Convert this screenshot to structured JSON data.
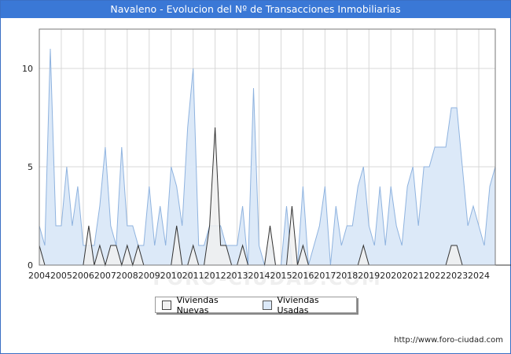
{
  "title": "Navaleno - Evolucion del Nº de Transacciones Inmobiliarias",
  "footer": "http://www.foro-ciudad.com",
  "watermark": "FORO-CIUDAD.COM",
  "colors": {
    "header": "#3a78d6",
    "nuevas_fill": "#f0f0f0",
    "nuevas_line": "#333333",
    "usadas_fill": "#dce9f8",
    "usadas_line": "#8fb3df",
    "grid": "#d8d8d8"
  },
  "chart_data": {
    "type": "area",
    "x_ticks": [
      "2004",
      "2005",
      "2006",
      "2007",
      "2008",
      "2009",
      "2010",
      "2011",
      "2012",
      "2013",
      "2014",
      "2015",
      "2016",
      "2017",
      "2018",
      "2019",
      "2020",
      "2021",
      "2022",
      "2023",
      "2024"
    ],
    "y_ticks": [
      0,
      5,
      10
    ],
    "ylim": [
      0,
      12
    ],
    "xlim": [
      2004,
      2024.75
    ],
    "grid": true,
    "legend_position": "bottom",
    "series": [
      {
        "name": "Viviendas Nuevas",
        "values": [
          1,
          0,
          0,
          0,
          0,
          0,
          0,
          0,
          0,
          2,
          0,
          1,
          0,
          1,
          1,
          0,
          1,
          0,
          1,
          0,
          0,
          0,
          0,
          0,
          0,
          2,
          0,
          0,
          1,
          0,
          0,
          2,
          7,
          1,
          1,
          0,
          0,
          1,
          0,
          0,
          0,
          0,
          2,
          0,
          0,
          0,
          3,
          0,
          1,
          0,
          0,
          0,
          0,
          0,
          0,
          0,
          0,
          0,
          0,
          1,
          0,
          0,
          0,
          0,
          0,
          0,
          0,
          0,
          0,
          0,
          0,
          0,
          0,
          0,
          0,
          1,
          1,
          0,
          0,
          0,
          0,
          0,
          0,
          0,
          0,
          0,
          0,
          0,
          0,
          0,
          0,
          0,
          0,
          0,
          0,
          0
        ]
      },
      {
        "name": "Viviendas Usadas",
        "values": [
          2,
          1,
          11,
          2,
          2,
          5,
          2,
          4,
          1,
          1,
          1,
          3,
          6,
          2,
          1,
          6,
          2,
          2,
          1,
          1,
          4,
          1,
          3,
          1,
          5,
          4,
          2,
          7,
          10,
          1,
          1,
          2,
          2,
          2,
          1,
          1,
          1,
          3,
          0,
          9,
          1,
          0,
          1,
          0,
          0,
          3,
          0,
          0,
          4,
          0,
          1,
          2,
          4,
          0,
          3,
          1,
          2,
          2,
          4,
          5,
          2,
          1,
          4,
          1,
          4,
          2,
          1,
          4,
          5,
          2,
          5,
          5,
          6,
          6,
          6,
          8,
          8,
          5,
          2,
          3,
          2,
          1,
          4,
          5
        ]
      }
    ]
  }
}
